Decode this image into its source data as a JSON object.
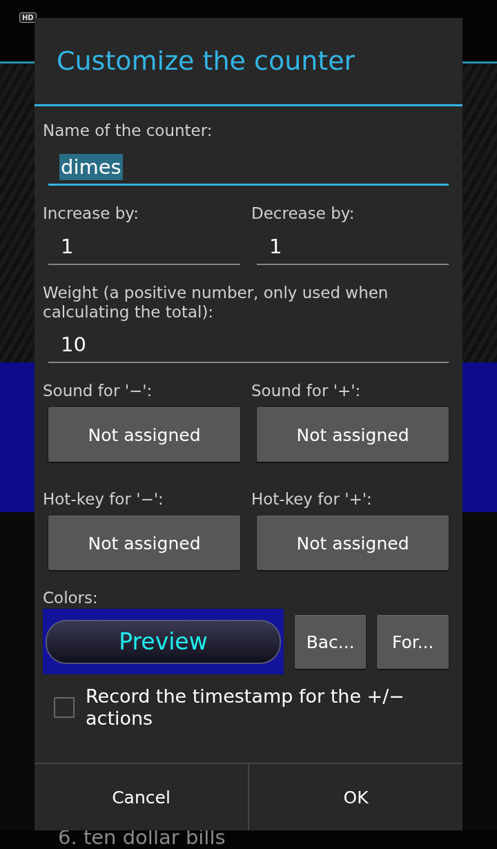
{
  "background": {
    "badge": "HD",
    "list_item": "6. ten dollar bills"
  },
  "dialog": {
    "title": "Customize the counter",
    "name_field": {
      "label": "Name of the counter:",
      "value": "dimes",
      "text_selected": true
    },
    "step_fields": [
      {
        "label": "Increase by:",
        "value": "1"
      },
      {
        "label": "Decrease by:",
        "value": "1"
      }
    ],
    "weight_field": {
      "label": "Weight (a positive number, only used when calculating the total):",
      "value": "10"
    },
    "sounds": [
      {
        "label": "Sound for '−':",
        "button": "Not assigned"
      },
      {
        "label": "Sound for '+':",
        "button": "Not assigned"
      }
    ],
    "hotkeys": [
      {
        "label": "Hot-key for '−':",
        "button": "Not assigned"
      },
      {
        "label": "Hot-key for '+':",
        "button": "Not assigned"
      }
    ],
    "colors": {
      "label": "Colors:",
      "preview": {
        "label": "Preview",
        "swatches": [
          {
            "kind": "background",
            "color": "#13139a"
          },
          {
            "kind": "text",
            "color": "#1ff0f0"
          }
        ]
      },
      "buttons": [
        "Bac...",
        "For..."
      ]
    },
    "timestamp": {
      "label": "Record the timestamp for the +/− actions",
      "checked": false
    },
    "buttons": [
      "Cancel",
      "OK"
    ]
  }
}
